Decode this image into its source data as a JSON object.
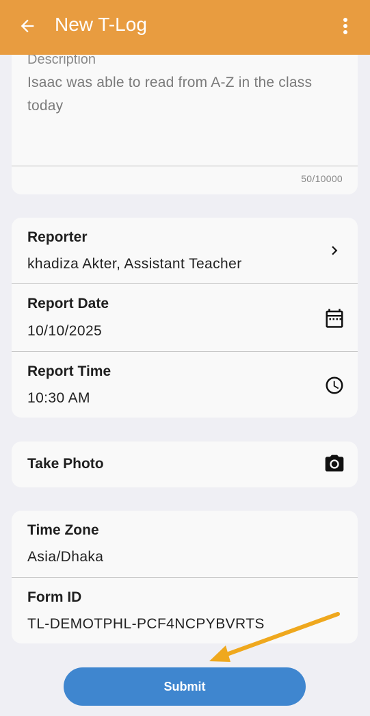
{
  "appbar": {
    "title": "New T-Log",
    "color": "#e89c40"
  },
  "description": {
    "label": "Description",
    "value": "Isaac was able to read from A-Z in the class today",
    "counter": "50/10000"
  },
  "report_card": {
    "reporter": {
      "label": "Reporter",
      "value": "khadiza Akter, Assistant Teacher",
      "icon": "chevron-right-icon"
    },
    "report_date": {
      "label": "Report Date",
      "value": "10/10/2025",
      "icon": "calendar-icon"
    },
    "report_time": {
      "label": "Report Time",
      "value": "10:30 AM",
      "icon": "clock-icon"
    }
  },
  "photo_card": {
    "label": "Take Photo",
    "icon": "camera-icon"
  },
  "info_card": {
    "time_zone": {
      "label": "Time Zone",
      "value": "Asia/Dhaka"
    },
    "form_id": {
      "label": "Form ID",
      "value": "TL-DEMOTPHL-PCF4NCPYBVRTS"
    }
  },
  "submit": {
    "label": "Submit",
    "color": "#3f86cf"
  },
  "annotation": {
    "arrow_color": "#efa81e"
  }
}
